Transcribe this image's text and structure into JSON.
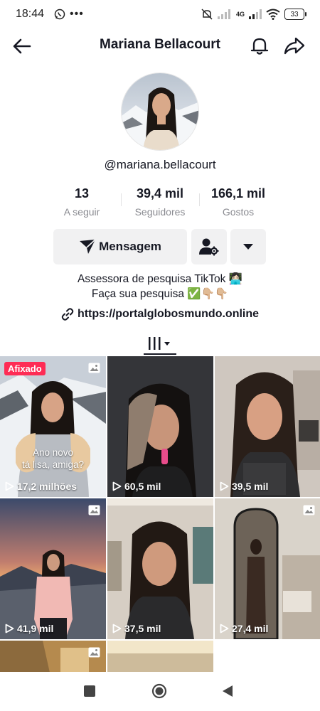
{
  "status_bar": {
    "time": "18:44",
    "network": "4G",
    "battery": "33"
  },
  "header": {
    "title": "Mariana Bellacourt"
  },
  "profile": {
    "username": "@mariana.bellacourt",
    "stats": [
      {
        "value": "13",
        "label": "A seguir"
      },
      {
        "value": "39,4 mil",
        "label": "Seguidores"
      },
      {
        "value": "166,1 mil",
        "label": "Gostos"
      }
    ],
    "message_button": "Mensagem",
    "bio_line1": "Assessora de pesquisa TikTok 👩🏻‍💻",
    "bio_line2": "Faça sua pesquisa ✅👇🏼👇🏼",
    "link": "https://portalglobosmundo.online"
  },
  "videos": [
    {
      "views": "17,2 milhões",
      "pinned_label": "Afixado",
      "caption": "Ano novo\ntá lisa, amiga?",
      "type": "photo"
    },
    {
      "views": "60,5 mil",
      "type": "video"
    },
    {
      "views": "39,5 mil",
      "type": "video"
    },
    {
      "views": "41,9 mil",
      "type": "photo"
    },
    {
      "views": "37,5 mil",
      "type": "video"
    },
    {
      "views": "27,4 mil",
      "type": "photo"
    },
    {
      "type": "photo"
    }
  ],
  "colors": {
    "pinned": "#fe2c55",
    "button_bg": "#f1f1f2",
    "muted_text": "#8a8b91"
  }
}
